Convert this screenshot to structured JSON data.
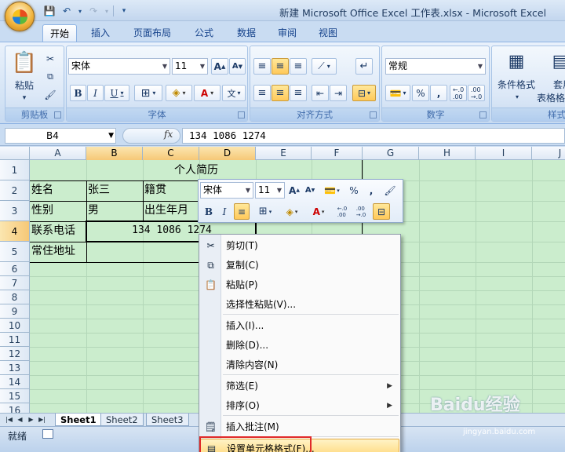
{
  "window": {
    "title": "新建 Microsoft Office Excel 工作表.xlsx - Microsoft Excel"
  },
  "tabs": [
    "开始",
    "插入",
    "页面布局",
    "公式",
    "数据",
    "审阅",
    "视图"
  ],
  "ribbon": {
    "clipboard": {
      "label": "剪贴板",
      "paste": "粘贴"
    },
    "font": {
      "label": "字体",
      "name": "宋体",
      "size": "11"
    },
    "alignment": {
      "label": "对齐方式"
    },
    "number": {
      "label": "数字",
      "format": "常规",
      "percent": "%",
      "comma": ","
    },
    "styles": {
      "label": "样式",
      "conditional": "条件格式",
      "table_line1": "套用",
      "table_line2": "表格格式"
    }
  },
  "formula_bar": {
    "name_box": "B4",
    "fx": "fx",
    "value": "134 1086 1274"
  },
  "columns": [
    "A",
    "B",
    "C",
    "D",
    "E",
    "F",
    "G",
    "H",
    "I",
    "J"
  ],
  "rows": [
    "1",
    "2",
    "3",
    "4",
    "5",
    "6",
    "7",
    "8",
    "9",
    "10",
    "11",
    "12",
    "13",
    "14",
    "15",
    "16"
  ],
  "cells": {
    "title": "个人简历",
    "a2": "姓名",
    "b2": "张三",
    "c2": "籍贯",
    "a3": "性别",
    "b3": "男",
    "c3": "出生年月",
    "a4": "联系电话",
    "b4": "134 1086 1274",
    "a5": "常住地址"
  },
  "sheets": [
    "Sheet1",
    "Sheet2",
    "Sheet3"
  ],
  "status": "就绪",
  "mini_toolbar": {
    "font": "宋体",
    "size": "11",
    "percent": "%",
    "comma": ","
  },
  "context_menu": {
    "cut": "剪切(T)",
    "copy": "复制(C)",
    "paste": "粘贴(P)",
    "paste_special": "选择性粘贴(V)...",
    "insert": "插入(I)...",
    "delete": "删除(D)...",
    "clear": "清除内容(N)",
    "filter": "筛选(E)",
    "sort": "排序(O)",
    "insert_comment": "插入批注(M)",
    "format_cells": "设置单元格格式(F)..."
  },
  "watermark": {
    "brand": "Baidu经验",
    "url": "jingyan.baidu.com"
  }
}
